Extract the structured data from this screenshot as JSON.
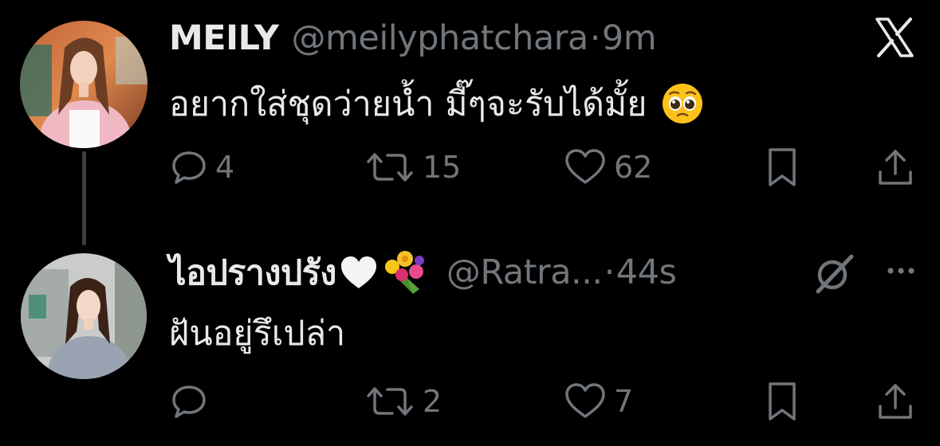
{
  "colors": {
    "background": "#000000",
    "text_primary": "#e7e9ea",
    "text_secondary": "#71767b",
    "thread_line": "#3a3f45"
  },
  "tweets": [
    {
      "author_name": "MEILY",
      "handle": "@meilyphatchara",
      "separator": "·",
      "time": "9m",
      "text": "อยากใส่ชุดว่ายน้ำ มี๊ๆจะรับได้มั้ย",
      "text_emoji": "pleading-face-emoji",
      "corner_icon": "x-logo-icon",
      "actions": {
        "reply": {
          "icon": "reply-icon",
          "count": "4"
        },
        "retweet": {
          "icon": "retweet-icon",
          "count": "15"
        },
        "like": {
          "icon": "heart-icon",
          "count": "62"
        },
        "bookmark": {
          "icon": "bookmark-icon"
        },
        "share": {
          "icon": "share-icon"
        }
      }
    },
    {
      "author_name": "ไอปรางปรัง",
      "name_emojis": [
        "white-heart-emoji",
        "bouquet-emoji"
      ],
      "handle": "@Ratra...",
      "separator": "·",
      "time": "44s",
      "text": "ฝันอยู่รึเปล่า",
      "corner_icons": [
        "grok-icon",
        "more-icon"
      ],
      "actions": {
        "reply": {
          "icon": "reply-icon",
          "count": ""
        },
        "retweet": {
          "icon": "retweet-icon",
          "count": "2"
        },
        "like": {
          "icon": "heart-icon",
          "count": "7"
        },
        "bookmark": {
          "icon": "bookmark-icon"
        },
        "share": {
          "icon": "share-icon"
        }
      }
    }
  ]
}
